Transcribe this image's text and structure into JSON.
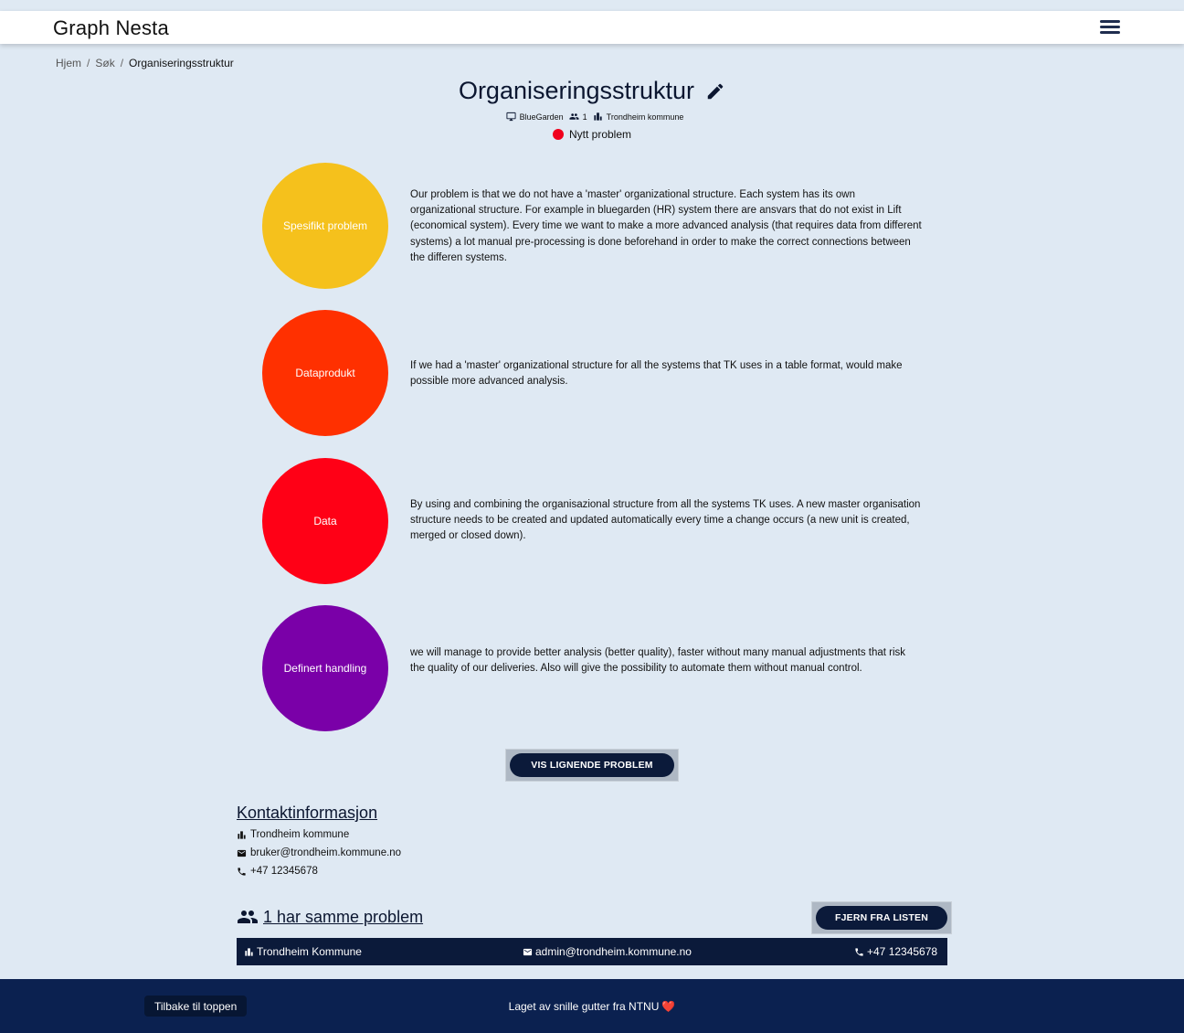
{
  "header": {
    "brand": "Graph Nesta",
    "menu_icon": "hamburger-menu-icon"
  },
  "breadcrumb": {
    "items": [
      "Hjem",
      "Søk"
    ],
    "current": "Organiseringsstruktur",
    "separator": "/"
  },
  "problem": {
    "title": "Organiseringsstruktur",
    "meta": {
      "system": "BlueGarden",
      "user_count": "1",
      "organization": "Trondheim kommune"
    },
    "status": {
      "label": "Nytt problem",
      "color": "#f0001c"
    }
  },
  "sections": [
    {
      "label": "Spesifikt problem",
      "color": "#f5c11c",
      "text": "Our problem is that we do not have a 'master' organizational structure. Each system has its own organizational structure. For example in bluegarden (HR) system there are ansvars that do not exist in Lift (economical system). Every time we want to make a more advanced analysis (that requires data from different systems) a lot manual pre-processing is done beforehand in order to make the correct connections between the differen systems."
    },
    {
      "label": "Dataprodukt",
      "color": "#ff3000",
      "text": "If we had a 'master' organizational structure for all the systems that TK uses in a table format, would make possible more advanced analysis."
    },
    {
      "label": "Data",
      "color": "#ff0016",
      "text": "By using and combining the organisazional structure from all the systems TK uses. A new master organisation structure needs to be created and updated automatically every time a change occurs (a new unit is created, merged or closed down)."
    },
    {
      "label": "Definert handling",
      "color": "#7a00a8",
      "text": "we will manage to provide better analysis (better quality), faster without many manual adjustments that risk the quality of our deliveries. Also will give the possibility to automate them without manual control."
    }
  ],
  "similar_button": "VIS LIGNENDE PROBLEM",
  "contact": {
    "title": "Kontaktinformasjon",
    "organization": "Trondheim kommune",
    "email": "bruker@trondheim.kommune.no",
    "phone": "+47 12345678"
  },
  "same_problem": {
    "link": "1 har samme problem",
    "remove_button": "FJERN FRA LISTEN",
    "rows": [
      {
        "organization": "Trondheim Kommune",
        "email": "admin@trondheim.kommune.no",
        "phone": "+47 12345678"
      }
    ]
  },
  "footer": {
    "back_to_top": "Tilbake til toppen",
    "credit": "Laget av snille gutter fra NTNU",
    "heart": "❤️"
  }
}
